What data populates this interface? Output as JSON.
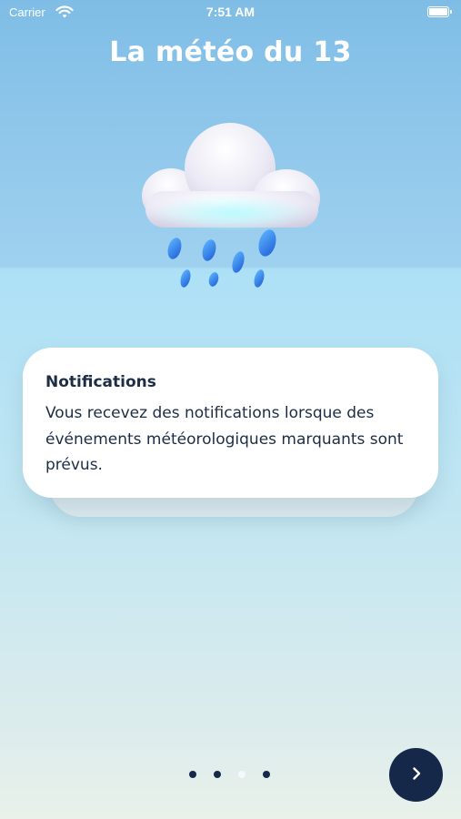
{
  "status_bar": {
    "carrier": "Carrier",
    "time": "7:51 AM",
    "icons": [
      "wifi-icon",
      "battery-icon"
    ]
  },
  "header": {
    "title": "La météo du 13"
  },
  "illustration": {
    "icon": "rain-cloud-icon"
  },
  "card": {
    "title": "Notifications",
    "body": "Vous recevez des notifications lorsque des événements météorologiques marquants sont prévus."
  },
  "pagination": {
    "total": 4,
    "active_index": 2
  },
  "next_button": {
    "icon": "chevron-right-icon"
  },
  "colors": {
    "primary": "#15284a",
    "text": "#1d2d45",
    "sky_top": "#7fbde6",
    "sky_bottom": "#e9f1ea"
  }
}
